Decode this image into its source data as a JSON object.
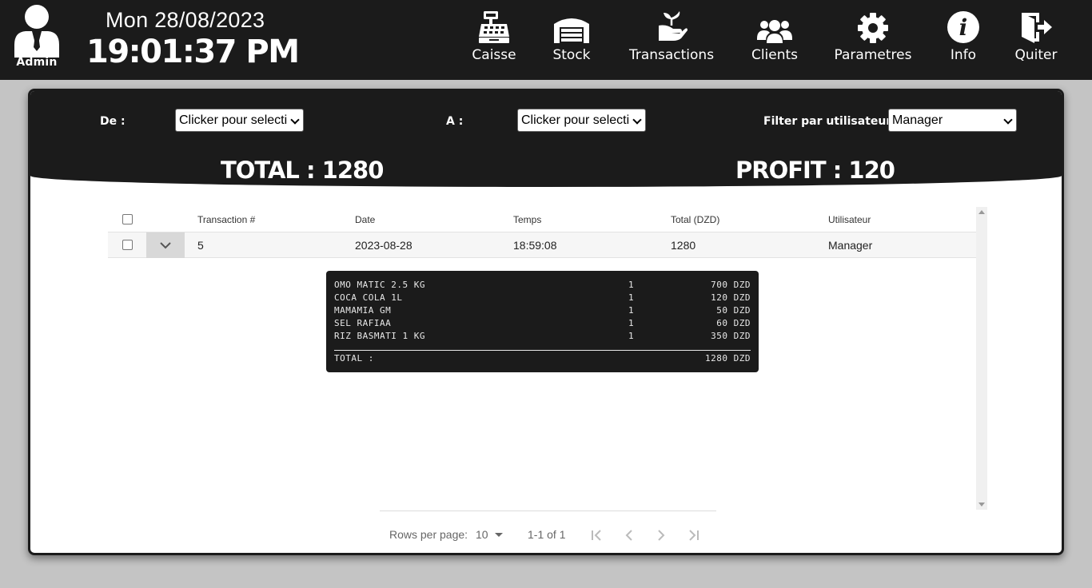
{
  "header": {
    "user_label": "Admin",
    "date": "Mon 28/08/2023",
    "time": "19:01:37 PM",
    "nav": [
      {
        "label": "Caisse",
        "icon": "cash-register-icon"
      },
      {
        "label": "Stock",
        "icon": "warehouse-icon"
      },
      {
        "label": "Transactions",
        "icon": "hand-seedling-icon"
      },
      {
        "label": "Clients",
        "icon": "users-icon"
      },
      {
        "label": "Parametres",
        "icon": "gear-icon"
      },
      {
        "label": "Info",
        "icon": "info-circle-icon"
      },
      {
        "label": "Quiter",
        "icon": "exit-door-icon"
      }
    ]
  },
  "filters": {
    "from_label": "De :",
    "from_value": "Clicker pour selecti",
    "to_label": "A :",
    "to_value": "Clicker pour selecti",
    "user_label": "Filter par utilisateur :",
    "user_value": "Manager"
  },
  "summary": {
    "total": "TOTAL : 1280",
    "profit": "PROFIT : 120"
  },
  "table": {
    "columns": [
      "Transaction #",
      "Date",
      "Temps",
      "Total (DZD)",
      "Utilisateur"
    ],
    "rows": [
      {
        "id": "5",
        "date": "2023-08-28",
        "time": "18:59:08",
        "total": "1280",
        "user": "Manager"
      }
    ]
  },
  "receipt": {
    "items": [
      {
        "name": "OMO MATIC 2.5 KG",
        "qty": "1",
        "price": "700 DZD"
      },
      {
        "name": "COCA COLA 1L",
        "qty": "1",
        "price": "120 DZD"
      },
      {
        "name": "MAMAMIA GM",
        "qty": "1",
        "price": "50 DZD"
      },
      {
        "name": "SEL RAFIAA",
        "qty": "1",
        "price": "60 DZD"
      },
      {
        "name": "RIZ BASMATI 1 KG",
        "qty": "1",
        "price": "350 DZD"
      }
    ],
    "total_label": "TOTAL :",
    "total_value": "1280 DZD"
  },
  "pagination": {
    "rows_per_page_label": "Rows per page:",
    "rows_per_page": "10",
    "range": "1-1 of 1"
  },
  "colors": {
    "bar": "#1b1b1b",
    "background": "#c4c4c4",
    "panel": "#ffffff"
  }
}
